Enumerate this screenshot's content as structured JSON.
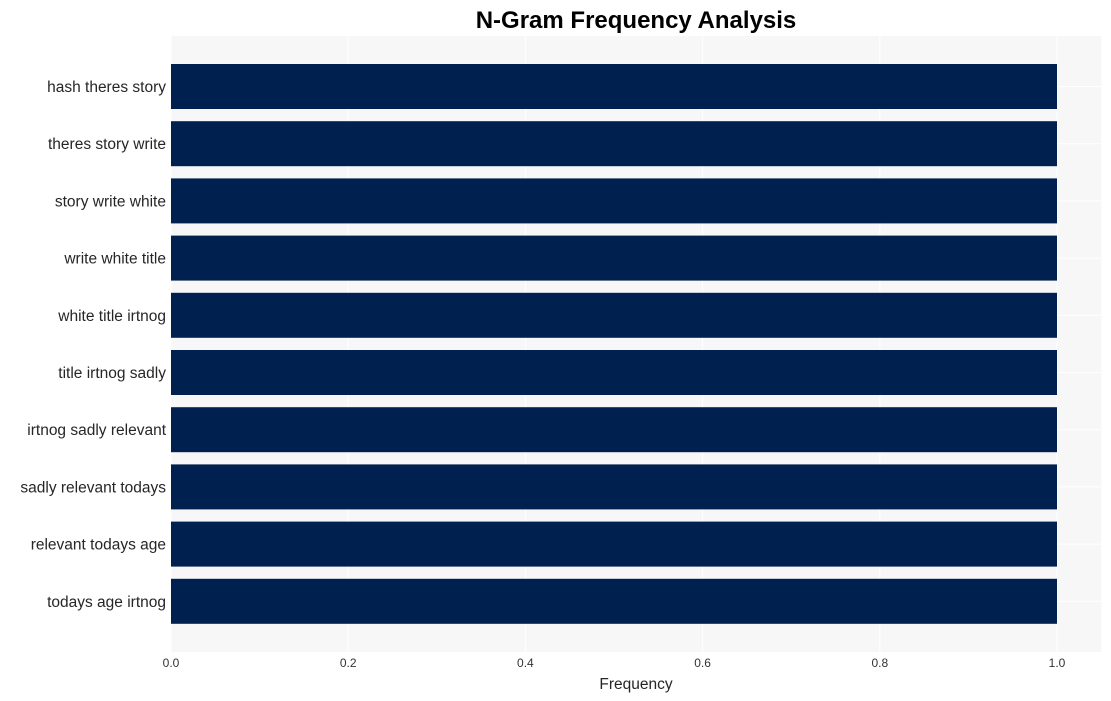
{
  "chart_data": {
    "type": "bar",
    "orientation": "horizontal",
    "title": "N-Gram Frequency Analysis",
    "xlabel": "Frequency",
    "ylabel": "",
    "xlim": [
      0.0,
      1.05
    ],
    "xticks": [
      "0.0",
      "0.2",
      "0.4",
      "0.6",
      "0.8",
      "1.0"
    ],
    "xtick_values": [
      0.0,
      0.2,
      0.4,
      0.6,
      0.8,
      1.0
    ],
    "grid": true,
    "legend": "none",
    "bar_color": "#002050",
    "background_color": "#f7f7f7",
    "categories": [
      "hash theres story",
      "theres story write",
      "story write white",
      "write white title",
      "white title irtnog",
      "title irtnog sadly",
      "irtnog sadly relevant",
      "sadly relevant todays",
      "relevant todays age",
      "todays age irtnog"
    ],
    "values": [
      1,
      1,
      1,
      1,
      1,
      1,
      1,
      1,
      1,
      1
    ]
  }
}
